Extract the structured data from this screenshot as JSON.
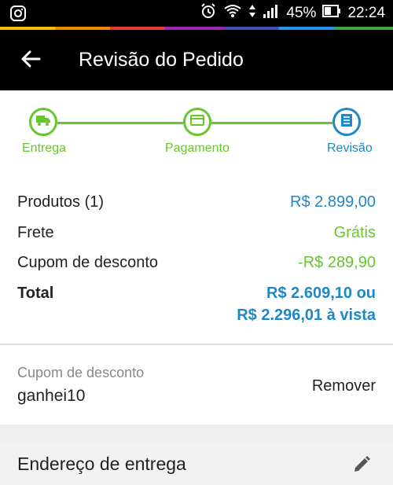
{
  "status_bar": {
    "battery": "45%",
    "time": "22:24"
  },
  "app_bar": {
    "title": "Revisão do Pedido"
  },
  "stepper": {
    "steps": [
      {
        "label": "Entrega",
        "icon": "truck-icon"
      },
      {
        "label": "Pagamento",
        "icon": "card-icon"
      },
      {
        "label": "Revisão",
        "icon": "list-icon"
      }
    ],
    "colors": {
      "done": "#65c82a",
      "current": "#1e88c7"
    }
  },
  "summary": {
    "products_label": "Produtos (1)",
    "products_value": "R$ 2.899,00",
    "shipping_label": "Frete",
    "shipping_value": "Grátis",
    "coupon_label": "Cupom de desconto",
    "coupon_value": "-R$ 289,90",
    "total_label": "Total",
    "total_value_line1": "R$ 2.609,10 ou",
    "total_value_line2": "R$ 2.296,01 à vista"
  },
  "coupon": {
    "label": "Cupom de desconto",
    "code": "ganhei10",
    "remove_label": "Remover"
  },
  "address": {
    "title": "Endereço de entrega"
  }
}
